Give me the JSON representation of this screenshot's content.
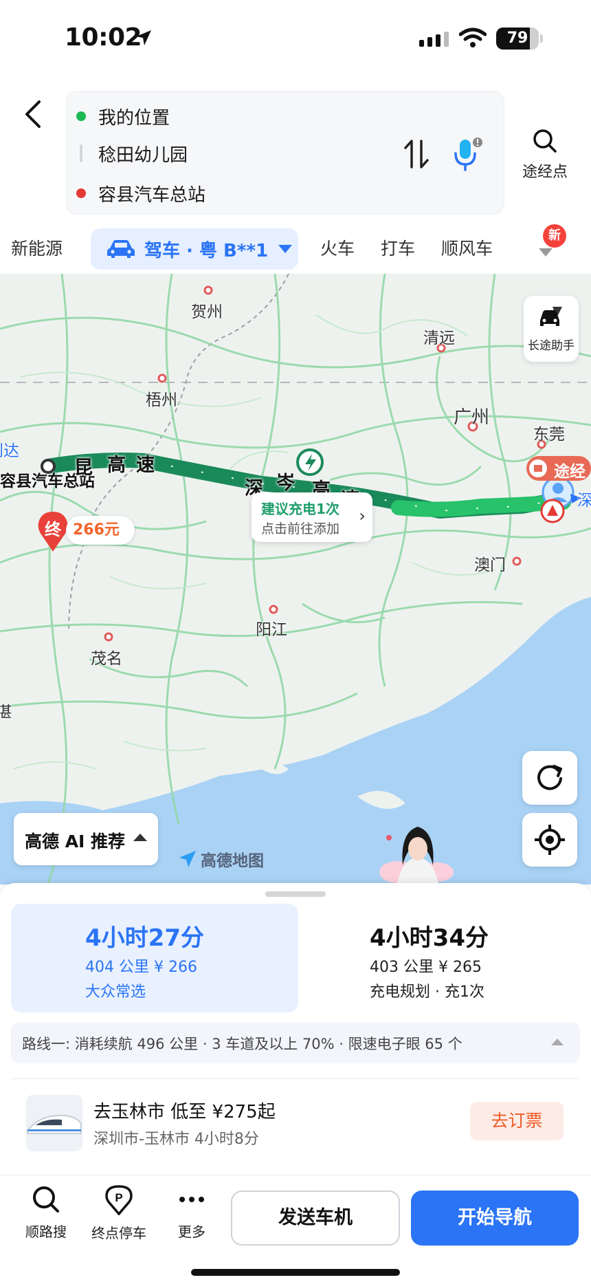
{
  "status": {
    "time": "10:02",
    "battery": "79",
    "battery_level": 0.79
  },
  "route": {
    "origin": "我的位置",
    "via": "稔田幼儿园",
    "destination": "容县汽车总站",
    "waypoint_label": "途经点"
  },
  "tabs": {
    "items": [
      "新能源",
      "火车",
      "打车",
      "顺风车"
    ],
    "drive_label": "驾车 · 粤 B**1",
    "new_badge": "新"
  },
  "map": {
    "cities": {
      "hezhou": "贺州",
      "wuzhou": "梧州",
      "qingyuan": "清远",
      "guangzhou": "广州",
      "dongguan": "东莞",
      "macau": "澳门",
      "yangjiang": "阳江",
      "maoming": "茂名",
      "edge_left": "到达",
      "edge_left2": "湛",
      "dest_label": "容县汽车总站",
      "edge_right": "深",
      "via_tag": "途经"
    },
    "highway_chars": [
      "昆",
      "高",
      "速",
      "深",
      "岑",
      "高",
      "速"
    ],
    "end_marker": "终",
    "price": "266元",
    "charge_title": "建议充电1次",
    "charge_sub": "点击前往添加",
    "longtrip_label": "长途助手",
    "ai_label": "高德 AI 推荐",
    "watermark": "高德地图"
  },
  "plans": [
    {
      "duration": "4小时27分",
      "detail": "404 公里  ¥ 266",
      "tag": "大众常选"
    },
    {
      "duration": "4小时34分",
      "detail": "403 公里  ¥ 265",
      "tag": "充电规划 · 充1次"
    }
  ],
  "route_info": "路线一:  消耗续航 496 公里 · 3 车道及以上 70% · 限速电子眼 65 个",
  "train": {
    "title": "去玉林市  低至 ¥275起",
    "subtitle": "深圳市-玉林市  4小时8分",
    "book_label": "去订票"
  },
  "actions": {
    "search_along": "顺路搜",
    "parking": "终点停车",
    "more": "更多",
    "send_car": "发送车机",
    "start_nav": "开始导航"
  },
  "colors": {
    "accent": "#2a74f5",
    "route": "#1a8a5a",
    "origin_dot": "#1db954",
    "dest_dot": "#e53935",
    "book": "#f05a2a"
  }
}
